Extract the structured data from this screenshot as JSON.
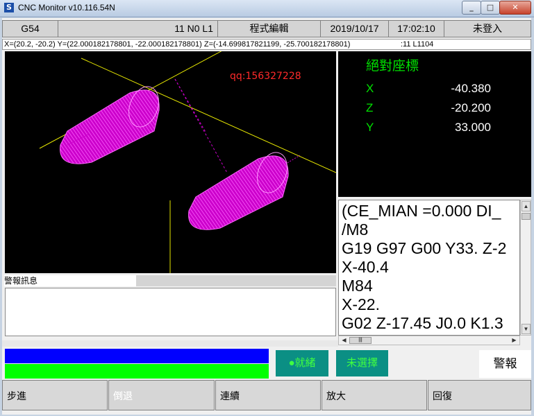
{
  "window": {
    "title": "CNC Monitor v10.116.54N",
    "app_icon": "S"
  },
  "status_bar": {
    "coord_system": "G54",
    "program_info": "11 N0 L1",
    "mode": "程式編輯",
    "date": "2019/10/17",
    "time": "17:02:10",
    "login": "未登入"
  },
  "coord_line": {
    "text": "X=(20.2, -20.2) Y=(22.000182178801, -22.000182178801) Z=(-14.699817821199, -25.700182178801)",
    "program_ref": ":11 L1104"
  },
  "viewport": {
    "watermark": "qq:156327228",
    "tool_color": "#ff00ff",
    "axis_color": "#ffff00"
  },
  "abs_coords": {
    "title": "絕對座標",
    "axes": [
      {
        "name": "X",
        "value": "-40.380"
      },
      {
        "name": "Z",
        "value": "-20.200"
      },
      {
        "name": "Y",
        "value": "33.000"
      }
    ]
  },
  "alarm_panel": {
    "header": "警報訊息"
  },
  "program_lines": [
    "(CE_MIAN =0.000  DI_",
    "/M8",
    "G19 G97 G00 Y33. Z-2",
    "X-40.4",
    "M84",
    "X-22.",
    "G02 Z-17.45  J0.0 K1.3"
  ],
  "indicators": {
    "ready": "●就緒",
    "not_selected": "未選擇",
    "alarm": "警報",
    "blue_bar": "#0000ff",
    "green_bar": "#00ff00"
  },
  "function_keys": [
    {
      "label": "步進",
      "enabled": true
    },
    {
      "label": "倒退",
      "enabled": false
    },
    {
      "label": "連續",
      "enabled": true
    },
    {
      "label": "放大",
      "enabled": true
    },
    {
      "label": "回復",
      "enabled": true
    }
  ]
}
